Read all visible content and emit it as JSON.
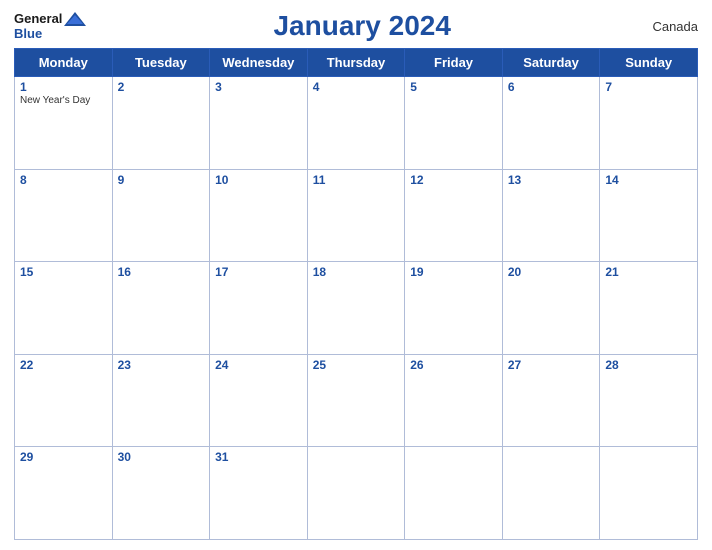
{
  "logo": {
    "general": "General",
    "blue": "Blue",
    "icon_color": "#1e4fa0"
  },
  "header": {
    "title": "January 2024",
    "country": "Canada"
  },
  "days_of_week": [
    "Monday",
    "Tuesday",
    "Wednesday",
    "Thursday",
    "Friday",
    "Saturday",
    "Sunday"
  ],
  "weeks": [
    [
      {
        "day": "1",
        "holiday": "New Year's Day"
      },
      {
        "day": "2",
        "holiday": ""
      },
      {
        "day": "3",
        "holiday": ""
      },
      {
        "day": "4",
        "holiday": ""
      },
      {
        "day": "5",
        "holiday": ""
      },
      {
        "day": "6",
        "holiday": ""
      },
      {
        "day": "7",
        "holiday": ""
      }
    ],
    [
      {
        "day": "8",
        "holiday": ""
      },
      {
        "day": "9",
        "holiday": ""
      },
      {
        "day": "10",
        "holiday": ""
      },
      {
        "day": "11",
        "holiday": ""
      },
      {
        "day": "12",
        "holiday": ""
      },
      {
        "day": "13",
        "holiday": ""
      },
      {
        "day": "14",
        "holiday": ""
      }
    ],
    [
      {
        "day": "15",
        "holiday": ""
      },
      {
        "day": "16",
        "holiday": ""
      },
      {
        "day": "17",
        "holiday": ""
      },
      {
        "day": "18",
        "holiday": ""
      },
      {
        "day": "19",
        "holiday": ""
      },
      {
        "day": "20",
        "holiday": ""
      },
      {
        "day": "21",
        "holiday": ""
      }
    ],
    [
      {
        "day": "22",
        "holiday": ""
      },
      {
        "day": "23",
        "holiday": ""
      },
      {
        "day": "24",
        "holiday": ""
      },
      {
        "day": "25",
        "holiday": ""
      },
      {
        "day": "26",
        "holiday": ""
      },
      {
        "day": "27",
        "holiday": ""
      },
      {
        "day": "28",
        "holiday": ""
      }
    ],
    [
      {
        "day": "29",
        "holiday": ""
      },
      {
        "day": "30",
        "holiday": ""
      },
      {
        "day": "31",
        "holiday": ""
      },
      {
        "day": "",
        "holiday": ""
      },
      {
        "day": "",
        "holiday": ""
      },
      {
        "day": "",
        "holiday": ""
      },
      {
        "day": "",
        "holiday": ""
      }
    ]
  ]
}
